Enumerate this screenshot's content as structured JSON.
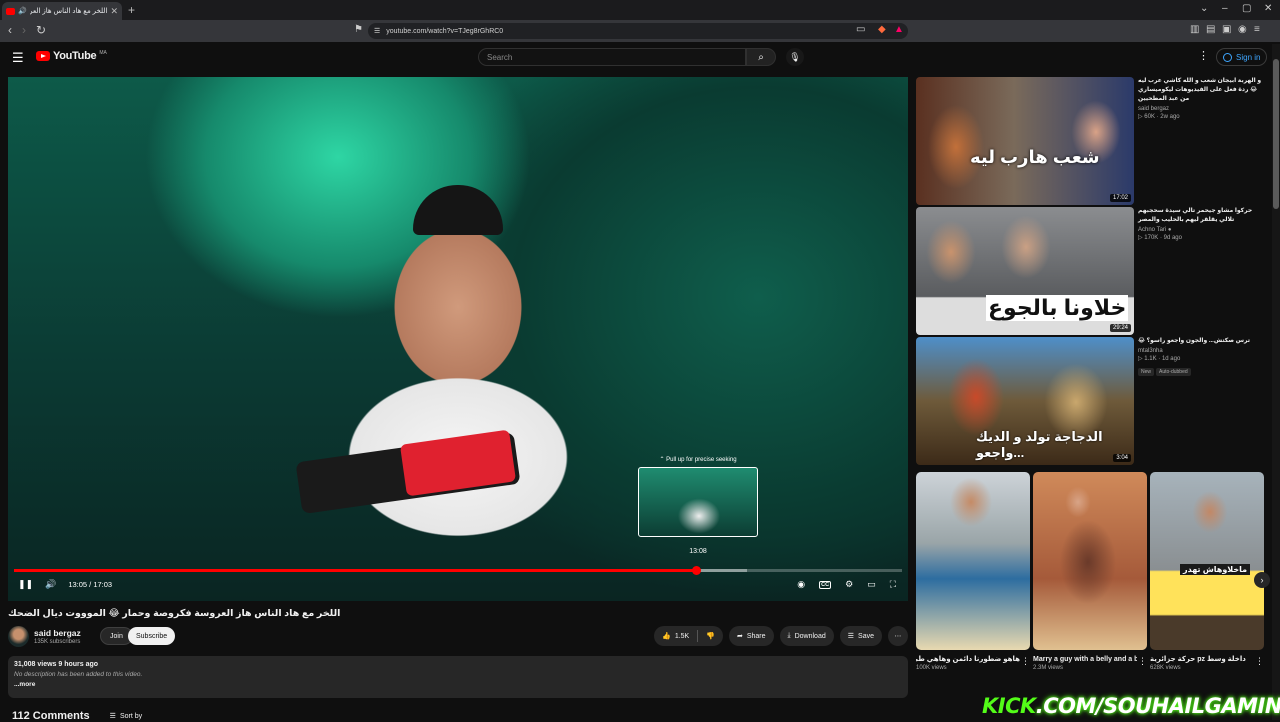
{
  "browser": {
    "tab_title": "اللخر مع هاد الناس هاز العروسة...",
    "url": "youtube.com/watch?v=TJeg8rGhRC0"
  },
  "header": {
    "logo_text": "YouTube",
    "logo_country": "MA",
    "search_placeholder": "Search",
    "signin_label": "Sign in"
  },
  "player": {
    "current_time": "13:05",
    "duration": "17:03",
    "time_display": "13:05 / 17:03",
    "progress": 0.768,
    "buffered": 0.826,
    "preview_hint": "Pull up for precise seeking",
    "preview_time": "13:08",
    "cc_label": "CC"
  },
  "video": {
    "title": "اللخر مع هاد الناس هاز العروسة فكروصة وحمار 😂 الموووت ديال الضحك",
    "channel": "said bergaz",
    "subscribers": "135K subscribers",
    "join_label": "Join",
    "subscribe_label": "Subscribe",
    "likes": "1.5K",
    "share_label": "Share",
    "download_label": "Download",
    "save_label": "Save",
    "views_age": "31,008 views  9 hours ago",
    "description_empty": "No description has been added to this video.",
    "more_label": "...more",
    "comments_count": "112 Comments",
    "sort_label": "Sort by"
  },
  "sidebar": [
    {
      "title": "و الهربة ابيجان شعب و الله كاشي عرب ليه 😂 ردة فعل على الفيديوهات ليكوميساري من عبد المطحيين",
      "channel": "said bergaz",
      "stats": "60K · 2w ago",
      "duration": "17:02",
      "thumb_text": "شعب هارب ليه"
    },
    {
      "title": "حركوا مشاو جيحمر تالي سيدة سحجبهم تلالي يقلقر ليهم بالحليب والمصر",
      "channel": "Achno Tari",
      "stats": "170K · 9d ago",
      "duration": "29:24",
      "thumb_text": "خلاونا بالجوع"
    },
    {
      "title": "ترس صكتش... والجون واجعو راسو؟ 😂",
      "channel": "mtal3nha",
      "stats": "1.1K · 1d ago",
      "badge_new": "New",
      "badge_dub": "Auto-dubbed",
      "duration": "3:04",
      "thumb_text": "الدجاجة تولد و الديك واجعو..."
    }
  ],
  "shorts": [
    {
      "title": "هاهو ضطورنا دائمن وهاهي طبيلتنا",
      "views": "100K views",
      "thumb_text": ""
    },
    {
      "title": "Marry a guy with a belly and a bald head ...",
      "views": "2.3M views",
      "thumb_text": ""
    },
    {
      "title": "داخلة وسط pz حركة جزائرية",
      "views": "628K views",
      "thumb_text": "ماخلاوهاش تهدر"
    }
  ],
  "watermark": {
    "prefix": "KICK",
    "rest": ".COM/SOUHAILGAMING"
  },
  "colors": {
    "accent": "#ff0000",
    "link": "#3ea6ff",
    "kick": "#53fc18"
  }
}
